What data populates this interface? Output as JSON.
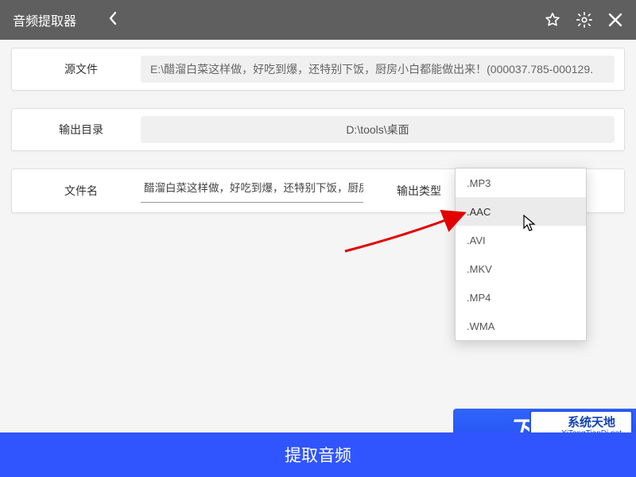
{
  "titlebar": {
    "title": "音频提取器"
  },
  "source": {
    "label": "源文件",
    "value": "E:\\醋溜白菜这样做，好吃到爆，还特别下饭，厨房小白都能做出来！(000037.785-000129."
  },
  "output_dir": {
    "label": "输出目录",
    "value": "D:\\tools\\桌面"
  },
  "filename": {
    "label": "文件名",
    "value": "醋溜白菜这样做，好吃到爆，还特别下饭，厨房小白"
  },
  "output_type": {
    "label": "输出类型",
    "options": [
      ".MP3",
      ".AAC",
      ".AVI",
      ".MKV",
      ".MP4",
      ".WMA"
    ],
    "hovered_index": 1
  },
  "action_button": {
    "label": "提取音频"
  },
  "watermark": {
    "brand": "系统天地",
    "url": "XiTongTianDi.net",
    "bgtext": "下载吧"
  }
}
